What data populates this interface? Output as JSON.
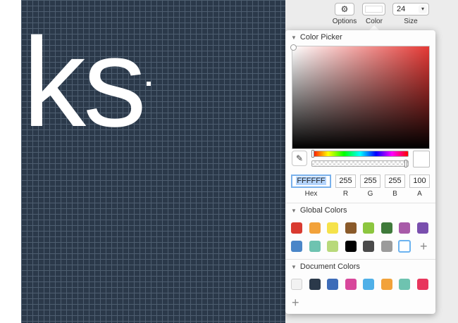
{
  "canvas": {
    "text": "ks"
  },
  "toolbar": {
    "options_label": "Options",
    "color_label": "Color",
    "size_label": "Size",
    "size_value": "24",
    "selected_color": "#FFFFFF"
  },
  "picker": {
    "section_title": "Color Picker",
    "hex": {
      "value": "FFFFFF",
      "label": "Hex"
    },
    "r": {
      "value": "255",
      "label": "R"
    },
    "g": {
      "value": "255",
      "label": "G"
    },
    "b": {
      "value": "255",
      "label": "B"
    },
    "a": {
      "value": "100",
      "label": "A"
    },
    "hue_color": "#e53935"
  },
  "global_colors": {
    "title": "Global Colors",
    "row1": [
      "#d93a30",
      "#f2a23a",
      "#f5e24a",
      "#8a5a2a",
      "#8cc63f",
      "#3f7a3a",
      "#a85aa8",
      "#7a4fae"
    ],
    "row2": [
      "#4a86c8",
      "#6ec3b0",
      "#b8d97a",
      "#000000",
      "#4a4a4a",
      "#9b9b9b",
      "#ffffff"
    ],
    "selected_index_row2": 6
  },
  "document_colors": {
    "title": "Document Colors",
    "colors": [
      "#f2f2f2",
      "#2b394a",
      "#3d6cb8",
      "#d8479b",
      "#4fb0e8",
      "#f2a23a",
      "#6ec3b0",
      "#e8365d"
    ]
  }
}
